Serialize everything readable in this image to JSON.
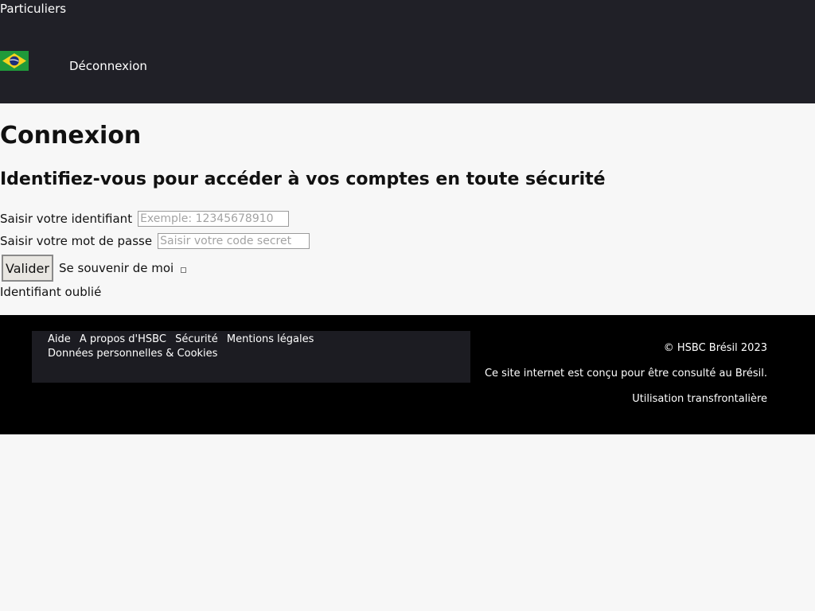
{
  "header": {
    "segment_link": "Particuliers",
    "country_flag": "flag-brazil-icon",
    "logout_label": "Déconnexion"
  },
  "main": {
    "title": "Connexion",
    "subtitle": "Identifiez-vous pour accéder à vos comptes en toute sécurité",
    "username_label": "Saisir votre identifiant",
    "username_placeholder": "Exemple: 12345678910",
    "username_value": "",
    "password_label": "Saisir votre mot de passe",
    "password_placeholder": "Saisir votre code secret",
    "password_value": "",
    "submit_label": "Valider",
    "remember_label": "Se souvenir de moi",
    "remember_checked": false,
    "forgot_link": "Identifiant oublié"
  },
  "footer": {
    "links": [
      "Aide",
      "A propos d'HSBC",
      "Sécurité",
      "Mentions légales",
      "Données personnelles & Cookies"
    ],
    "copyright": "© HSBC Brésil 2023",
    "notice": "Ce site internet est conçu pour être consulté au Brésil.",
    "cross_border_link": "Utilisation transfrontalière"
  },
  "colors": {
    "header_bg": "#202027",
    "footer_bg": "#000000",
    "footer_panel_bg": "#1c1c22",
    "page_bg": "#f7f7f7"
  }
}
